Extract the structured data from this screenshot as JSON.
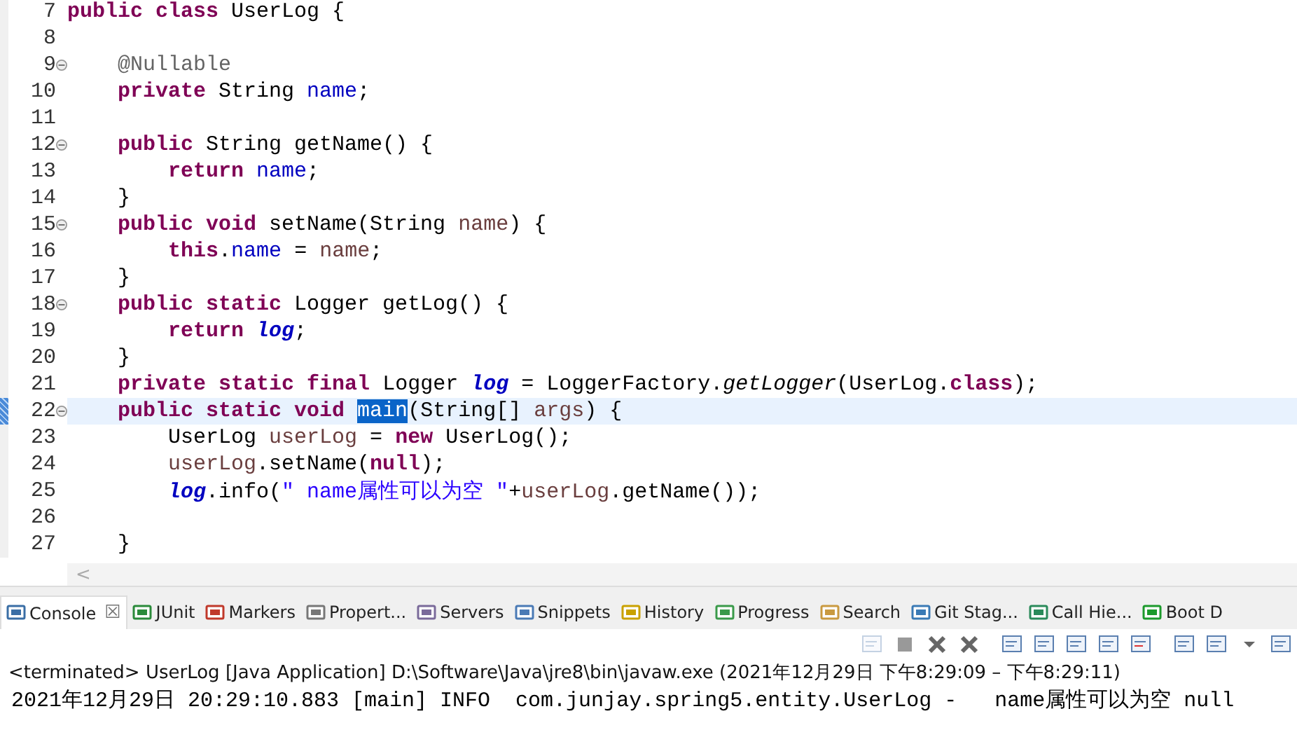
{
  "editor": {
    "lines": [
      {
        "number": "7",
        "fold": false,
        "current": false,
        "tokens": [
          {
            "text": "public",
            "kind": "kw"
          },
          {
            "text": " class",
            "kind": "kw"
          },
          {
            "text": " UserLog {",
            "kind": "plain"
          }
        ]
      },
      {
        "number": "8",
        "fold": false,
        "current": false
      },
      {
        "number": "9",
        "fold": true,
        "current": false,
        "tokens": [
          {
            "text": "    @Nullable",
            "kind": "annotation"
          }
        ]
      },
      {
        "number": "10",
        "fold": false,
        "current": false,
        "tokens": [
          {
            "text": "    private",
            "kind": "kw"
          },
          {
            "text": " String ",
            "kind": "plain"
          },
          {
            "text": "name",
            "kind": "field"
          },
          {
            "text": ";",
            "kind": "plain"
          }
        ]
      },
      {
        "number": "11",
        "fold": false,
        "current": false
      },
      {
        "number": "12",
        "fold": true,
        "current": false,
        "tokens": [
          {
            "text": "    public",
            "kind": "kw"
          },
          {
            "text": " String getName() {",
            "kind": "plain"
          }
        ]
      },
      {
        "number": "13",
        "fold": false,
        "current": false,
        "tokens": [
          {
            "text": "        return",
            "kind": "kw"
          },
          {
            "text": " name",
            "kind": "field"
          },
          {
            "text": ";",
            "kind": "plain"
          }
        ]
      },
      {
        "number": "14",
        "fold": false,
        "current": false,
        "tokens": [
          {
            "text": "    }",
            "kind": "plain"
          }
        ]
      },
      {
        "number": "15",
        "fold": true,
        "current": false,
        "tokens": [
          {
            "text": "    public",
            "kind": "kw"
          },
          {
            "text": " void",
            "kind": "kw"
          },
          {
            "text": " setName(String ",
            "kind": "plain"
          },
          {
            "text": "name",
            "kind": "local"
          },
          {
            "text": ") {",
            "kind": "plain"
          }
        ]
      },
      {
        "number": "16",
        "fold": false,
        "current": false,
        "tokens": [
          {
            "text": "        this",
            "kind": "kw"
          },
          {
            "text": ".",
            "kind": "plain"
          },
          {
            "text": "name",
            "kind": "field"
          },
          {
            "text": " = ",
            "kind": "plain"
          },
          {
            "text": "name",
            "kind": "local"
          },
          {
            "text": ";",
            "kind": "plain"
          }
        ]
      },
      {
        "number": "17",
        "fold": false,
        "current": false,
        "tokens": [
          {
            "text": "    }",
            "kind": "plain"
          }
        ]
      },
      {
        "number": "18",
        "fold": true,
        "current": false,
        "tokens": [
          {
            "text": "    public",
            "kind": "kw"
          },
          {
            "text": " static",
            "kind": "kw"
          },
          {
            "text": " Logger getLog() {",
            "kind": "plain"
          }
        ]
      },
      {
        "number": "19",
        "fold": false,
        "current": false,
        "tokens": [
          {
            "text": "        return",
            "kind": "kw"
          },
          {
            "text": " log",
            "kind": "static-field"
          },
          {
            "text": ";",
            "kind": "plain"
          }
        ]
      },
      {
        "number": "20",
        "fold": false,
        "current": false,
        "tokens": [
          {
            "text": "    }",
            "kind": "plain"
          }
        ]
      },
      {
        "number": "21",
        "fold": false,
        "current": false,
        "tokens": [
          {
            "text": "    private",
            "kind": "kw"
          },
          {
            "text": " static",
            "kind": "kw"
          },
          {
            "text": " final",
            "kind": "kw"
          },
          {
            "text": " Logger ",
            "kind": "plain"
          },
          {
            "text": "log",
            "kind": "static-field"
          },
          {
            "text": " = LoggerFactory.",
            "kind": "plain"
          },
          {
            "text": "getLogger",
            "kind": "static-method"
          },
          {
            "text": "(UserLog.",
            "kind": "plain"
          },
          {
            "text": "class",
            "kind": "kw"
          },
          {
            "text": ");",
            "kind": "plain"
          }
        ]
      },
      {
        "number": "22",
        "fold": true,
        "current": true,
        "tokens": [
          {
            "text": "    public",
            "kind": "kw"
          },
          {
            "text": " static",
            "kind": "kw"
          },
          {
            "text": " void ",
            "kind": "kw"
          },
          {
            "text": "main",
            "kind": "selection"
          },
          {
            "text": "(String[] ",
            "kind": "plain"
          },
          {
            "text": "args",
            "kind": "local"
          },
          {
            "text": ") {",
            "kind": "plain"
          }
        ]
      },
      {
        "number": "23",
        "fold": false,
        "current": false,
        "tokens": [
          {
            "text": "        UserLog ",
            "kind": "plain"
          },
          {
            "text": "userLog",
            "kind": "local"
          },
          {
            "text": " = ",
            "kind": "plain"
          },
          {
            "text": "new",
            "kind": "kw"
          },
          {
            "text": " UserLog();",
            "kind": "plain"
          }
        ]
      },
      {
        "number": "24",
        "fold": false,
        "current": false,
        "tokens": [
          {
            "text": "        userLog",
            "kind": "local"
          },
          {
            "text": ".setName(",
            "kind": "plain"
          },
          {
            "text": "null",
            "kind": "kw"
          },
          {
            "text": ");",
            "kind": "plain"
          }
        ]
      },
      {
        "number": "25",
        "fold": false,
        "current": false,
        "tokens": [
          {
            "text": "        log",
            "kind": "static-field"
          },
          {
            "text": ".info(",
            "kind": "plain"
          },
          {
            "text": "\" name属性可以为空 \"",
            "kind": "string"
          },
          {
            "text": "+",
            "kind": "plain"
          },
          {
            "text": "userLog",
            "kind": "local"
          },
          {
            "text": ".getName());",
            "kind": "plain"
          }
        ]
      },
      {
        "number": "26",
        "fold": false,
        "current": false
      },
      {
        "number": "27",
        "fold": false,
        "current": false,
        "tokens": [
          {
            "text": "    }",
            "kind": "plain"
          }
        ]
      }
    ],
    "scroll_left": "<"
  },
  "console": {
    "tabs": [
      {
        "label": "Console",
        "selected": true,
        "close": "☒"
      },
      {
        "label": "JUnit",
        "selected": false
      },
      {
        "label": "Markers",
        "selected": false
      },
      {
        "label": "Propert...",
        "selected": false
      },
      {
        "label": "Servers",
        "selected": false
      },
      {
        "label": "Snippets",
        "selected": false
      },
      {
        "label": "History",
        "selected": false
      },
      {
        "label": "Progress",
        "selected": false
      },
      {
        "label": "Search",
        "selected": false
      },
      {
        "label": "Git Stag...",
        "selected": false
      },
      {
        "label": "Call Hie...",
        "selected": false
      },
      {
        "label": "Boot D",
        "selected": false
      }
    ],
    "header": "<terminated> UserLog [Java Application] D:\\Software\\Java\\jre8\\bin\\javaw.exe  (2021年12月29日 下午8:29:09 – 下午8:29:11)",
    "output": [
      "2021年12月29日 20:29:10.883 [main] INFO  com.junjay.spring5.entity.UserLog -   name属性可以为空 null"
    ]
  }
}
